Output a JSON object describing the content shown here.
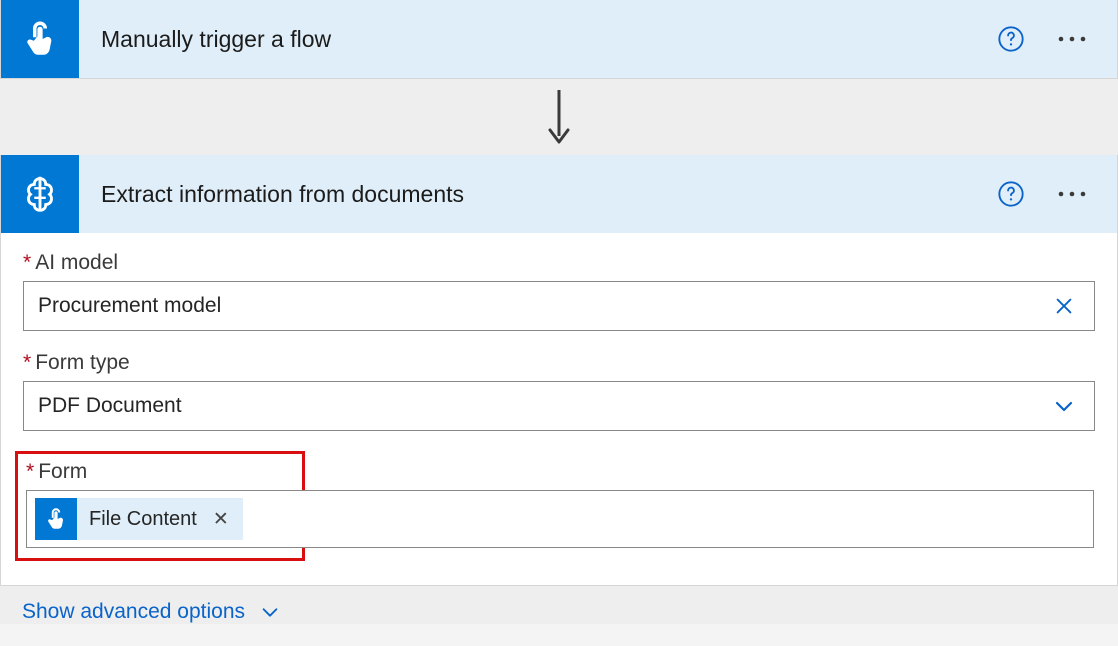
{
  "trigger": {
    "title": "Manually trigger a flow"
  },
  "action": {
    "title": "Extract information from documents",
    "fields": {
      "ai_model": {
        "label": "AI model",
        "value": "Procurement model",
        "required": true
      },
      "form_type": {
        "label": "Form type",
        "value": "PDF Document",
        "required": true
      },
      "form": {
        "label": "Form",
        "token": "File Content",
        "required": true
      }
    },
    "advanced_link": "Show advanced options"
  }
}
